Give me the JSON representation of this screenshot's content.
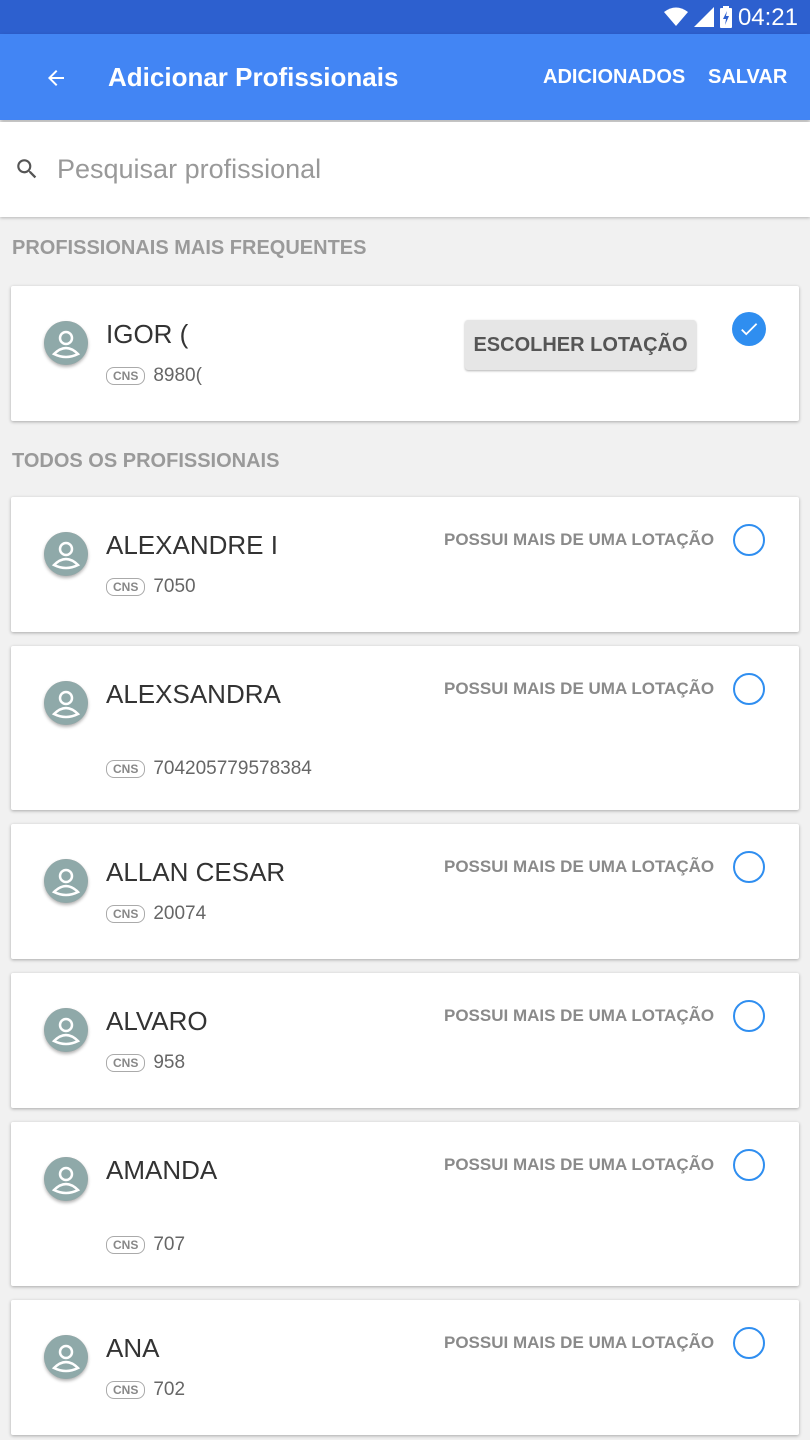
{
  "status_bar": {
    "time": "04:21"
  },
  "app_bar": {
    "title": "Adicionar Profissionais",
    "back_icon": "arrow-back-icon",
    "added_label": "ADICIONADOS",
    "save_label": "SALVAR"
  },
  "search": {
    "placeholder": "Pesquisar profissional",
    "value": ""
  },
  "frequent": {
    "section_title": "PROFISSIONAIS MAIS FREQUENTES",
    "items": [
      {
        "name": "IGOR (",
        "cns_label": "CNS",
        "cns": "8980(",
        "button_label": "ESCOLHER LOTAÇÃO",
        "selected": true
      }
    ]
  },
  "all": {
    "section_title": "TODOS OS PROFISSIONAIS",
    "items": [
      {
        "name": "ALEXANDRE I",
        "cns_label": "CNS",
        "cns": "7050",
        "multi_label": "POSSUI MAIS DE UMA LOTAÇÃO",
        "selected": false
      },
      {
        "name": "ALEXSANDRA",
        "cns_label": "CNS",
        "cns": "704205779578384",
        "multi_label": "POSSUI MAIS DE UMA LOTAÇÃO",
        "selected": false
      },
      {
        "name": "ALLAN CESAR",
        "cns_label": "CNS",
        "cns": "20074",
        "multi_label": "POSSUI MAIS DE UMA LOTAÇÃO",
        "selected": false
      },
      {
        "name": "ALVARO",
        "cns_label": "CNS",
        "cns": "958",
        "multi_label": "POSSUI MAIS DE UMA LOTAÇÃO",
        "selected": false
      },
      {
        "name": "AMANDA",
        "cns_label": "CNS",
        "cns": "707",
        "multi_label": "POSSUI MAIS DE UMA LOTAÇÃO",
        "selected": false
      },
      {
        "name": "ANA",
        "cns_label": "CNS",
        "cns": "702",
        "multi_label": "POSSUI MAIS DE UMA LOTAÇÃO",
        "selected": false
      }
    ]
  },
  "colors": {
    "status_bar": "#2d60cf",
    "app_bar": "#4285f4",
    "accent": "#2f8ef0"
  }
}
